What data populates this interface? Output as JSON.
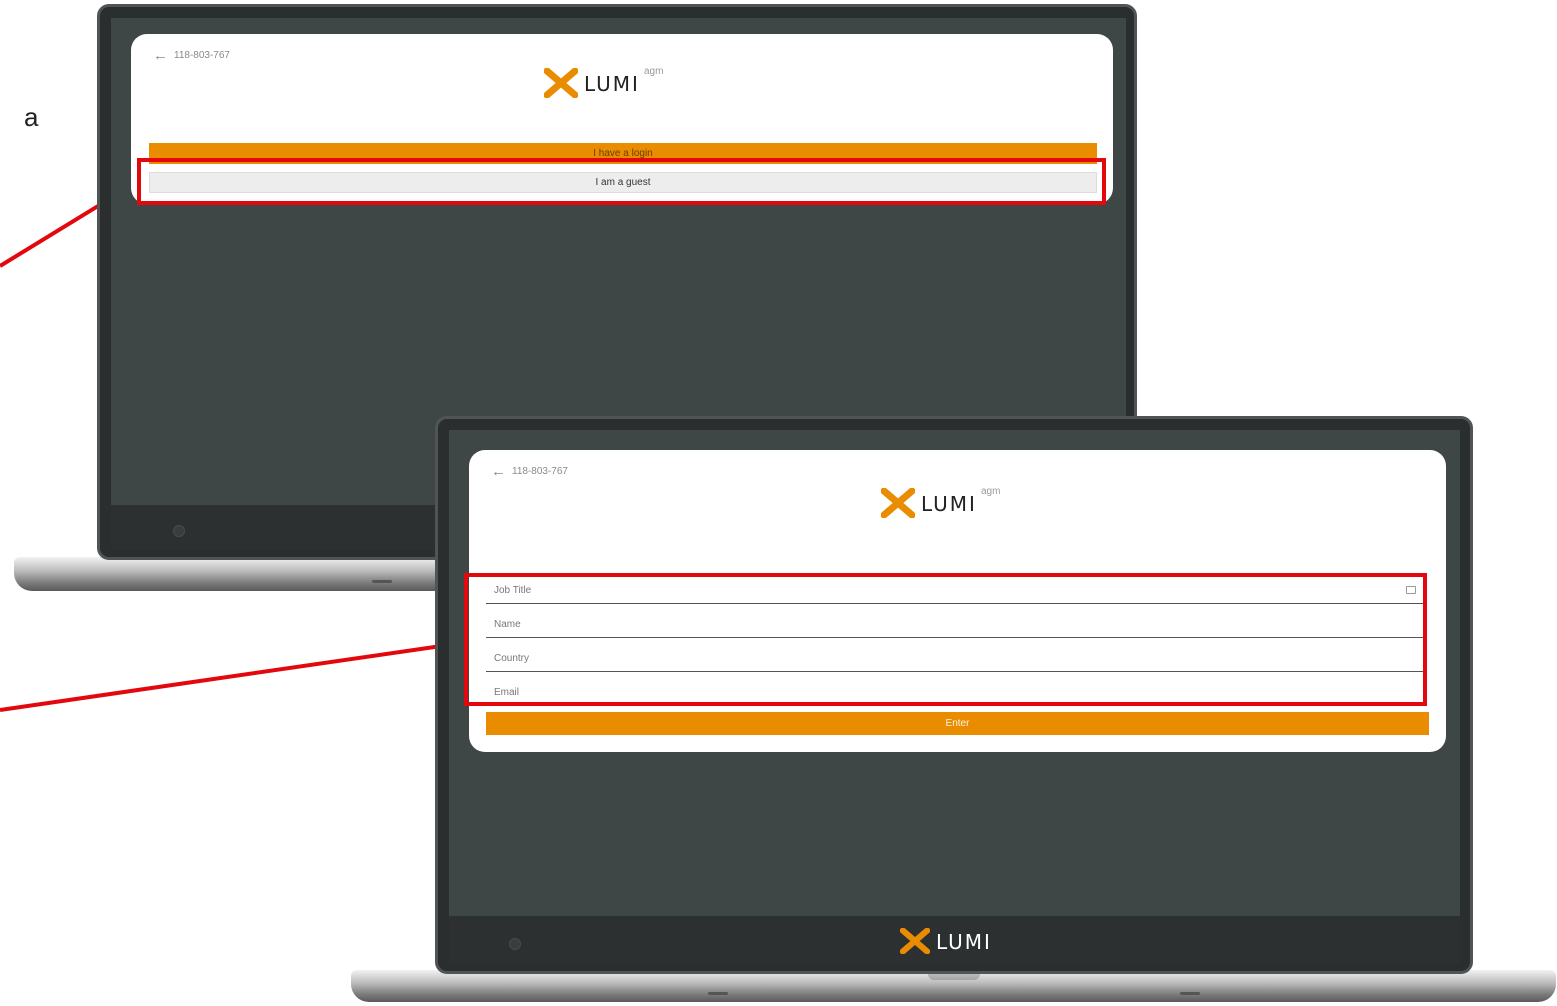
{
  "side_text": "a",
  "top_screen": {
    "back_label": "118-803-767",
    "logo_word": "LUMI",
    "logo_sup": "agm",
    "login_button": "I have a login",
    "guest_button": "I am a guest"
  },
  "bottom_screen": {
    "back_label": "118-803-767",
    "logo_word": "LUMI",
    "logo_sup": "agm",
    "fields": [
      {
        "placeholder": "Job Title"
      },
      {
        "placeholder": "Name"
      },
      {
        "placeholder": "Country"
      },
      {
        "placeholder": "Email"
      }
    ],
    "enter_button": "Enter",
    "bezel_logo_word": "LUMI"
  },
  "colors": {
    "accent": "#ea8c00",
    "highlight": "#e3080d",
    "screen_bg": "#3f4746"
  }
}
